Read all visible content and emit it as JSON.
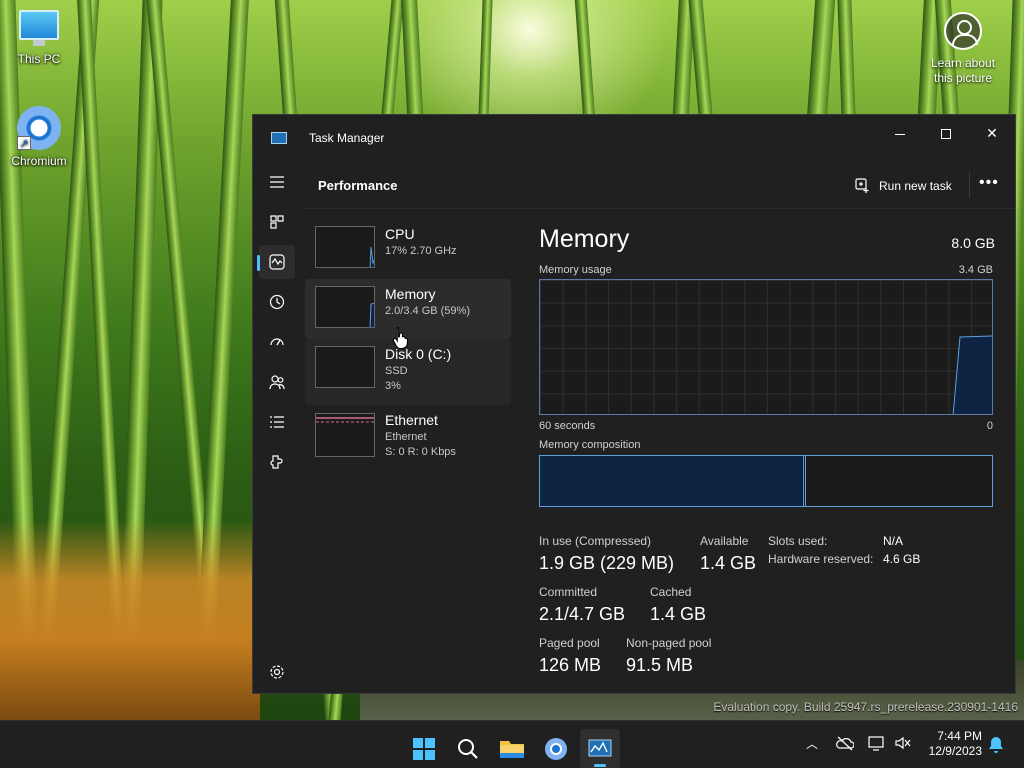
{
  "desktop": {
    "icons": [
      {
        "label": "This PC",
        "icon": "computer-icon"
      },
      {
        "label": "Chromium",
        "icon": "chromium-icon"
      }
    ],
    "learn_about": {
      "line1": "Learn about",
      "line2": "this picture"
    },
    "watermark": "Evaluation copy. Build 25947.rs_prerelease.230901-1416"
  },
  "window": {
    "title": "Task Manager",
    "page_title": "Performance",
    "run_new_task": "Run new task",
    "more_label": "•••"
  },
  "nav": [
    "menu-icon",
    "processes-icon",
    "performance-icon",
    "app-history-icon",
    "startup-apps-icon",
    "users-icon",
    "details-icon",
    "services-icon",
    "settings-icon"
  ],
  "resources": [
    {
      "name": "CPU",
      "line1": "17%  2.70 GHz",
      "line2": "",
      "usage_percent": 17
    },
    {
      "name": "Memory",
      "line1": "2.0/3.4 GB (59%)",
      "line2": "",
      "usage_percent": 59
    },
    {
      "name": "Disk 0 (C:)",
      "line1": "SSD",
      "line2": "3%",
      "usage_percent": 3
    },
    {
      "name": "Ethernet",
      "line1": "Ethernet",
      "line2": "S: 0  R: 0 Kbps",
      "usage_percent": 0
    }
  ],
  "memory": {
    "title": "Memory",
    "total": "8.0 GB",
    "usage_label": "Memory usage",
    "usage_max": "3.4 GB",
    "time_left": "60 seconds",
    "time_right": "0",
    "composition_label": "Memory composition",
    "composition": {
      "in_use_fraction": 0.58,
      "modified_fraction": 0.005
    },
    "stats": {
      "in_use_label": "In use (Compressed)",
      "in_use_value": "1.9 GB (229 MB)",
      "available_label": "Available",
      "available_value": "1.4 GB",
      "committed_label": "Committed",
      "committed_value": "2.1/4.7 GB",
      "cached_label": "Cached",
      "cached_value": "1.4 GB",
      "paged_label": "Paged pool",
      "paged_value": "126 MB",
      "nonpaged_label": "Non-paged pool",
      "nonpaged_value": "91.5 MB",
      "slots_label": "Slots used:",
      "slots_value": "N/A",
      "reserved_label": "Hardware reserved:",
      "reserved_value": "4.6 GB"
    }
  },
  "taskbar": {
    "apps": [
      "start-icon",
      "search-icon",
      "file-explorer-icon",
      "chromium-icon",
      "task-manager-icon"
    ],
    "time": "7:44 PM",
    "date": "12/9/2023"
  },
  "colors": {
    "accent": "#4cc2ff",
    "memory_graph_line": "#5b9fe0",
    "memory_graph_fill": "#0f2442",
    "ethernet_graph": "#d36d8a"
  }
}
